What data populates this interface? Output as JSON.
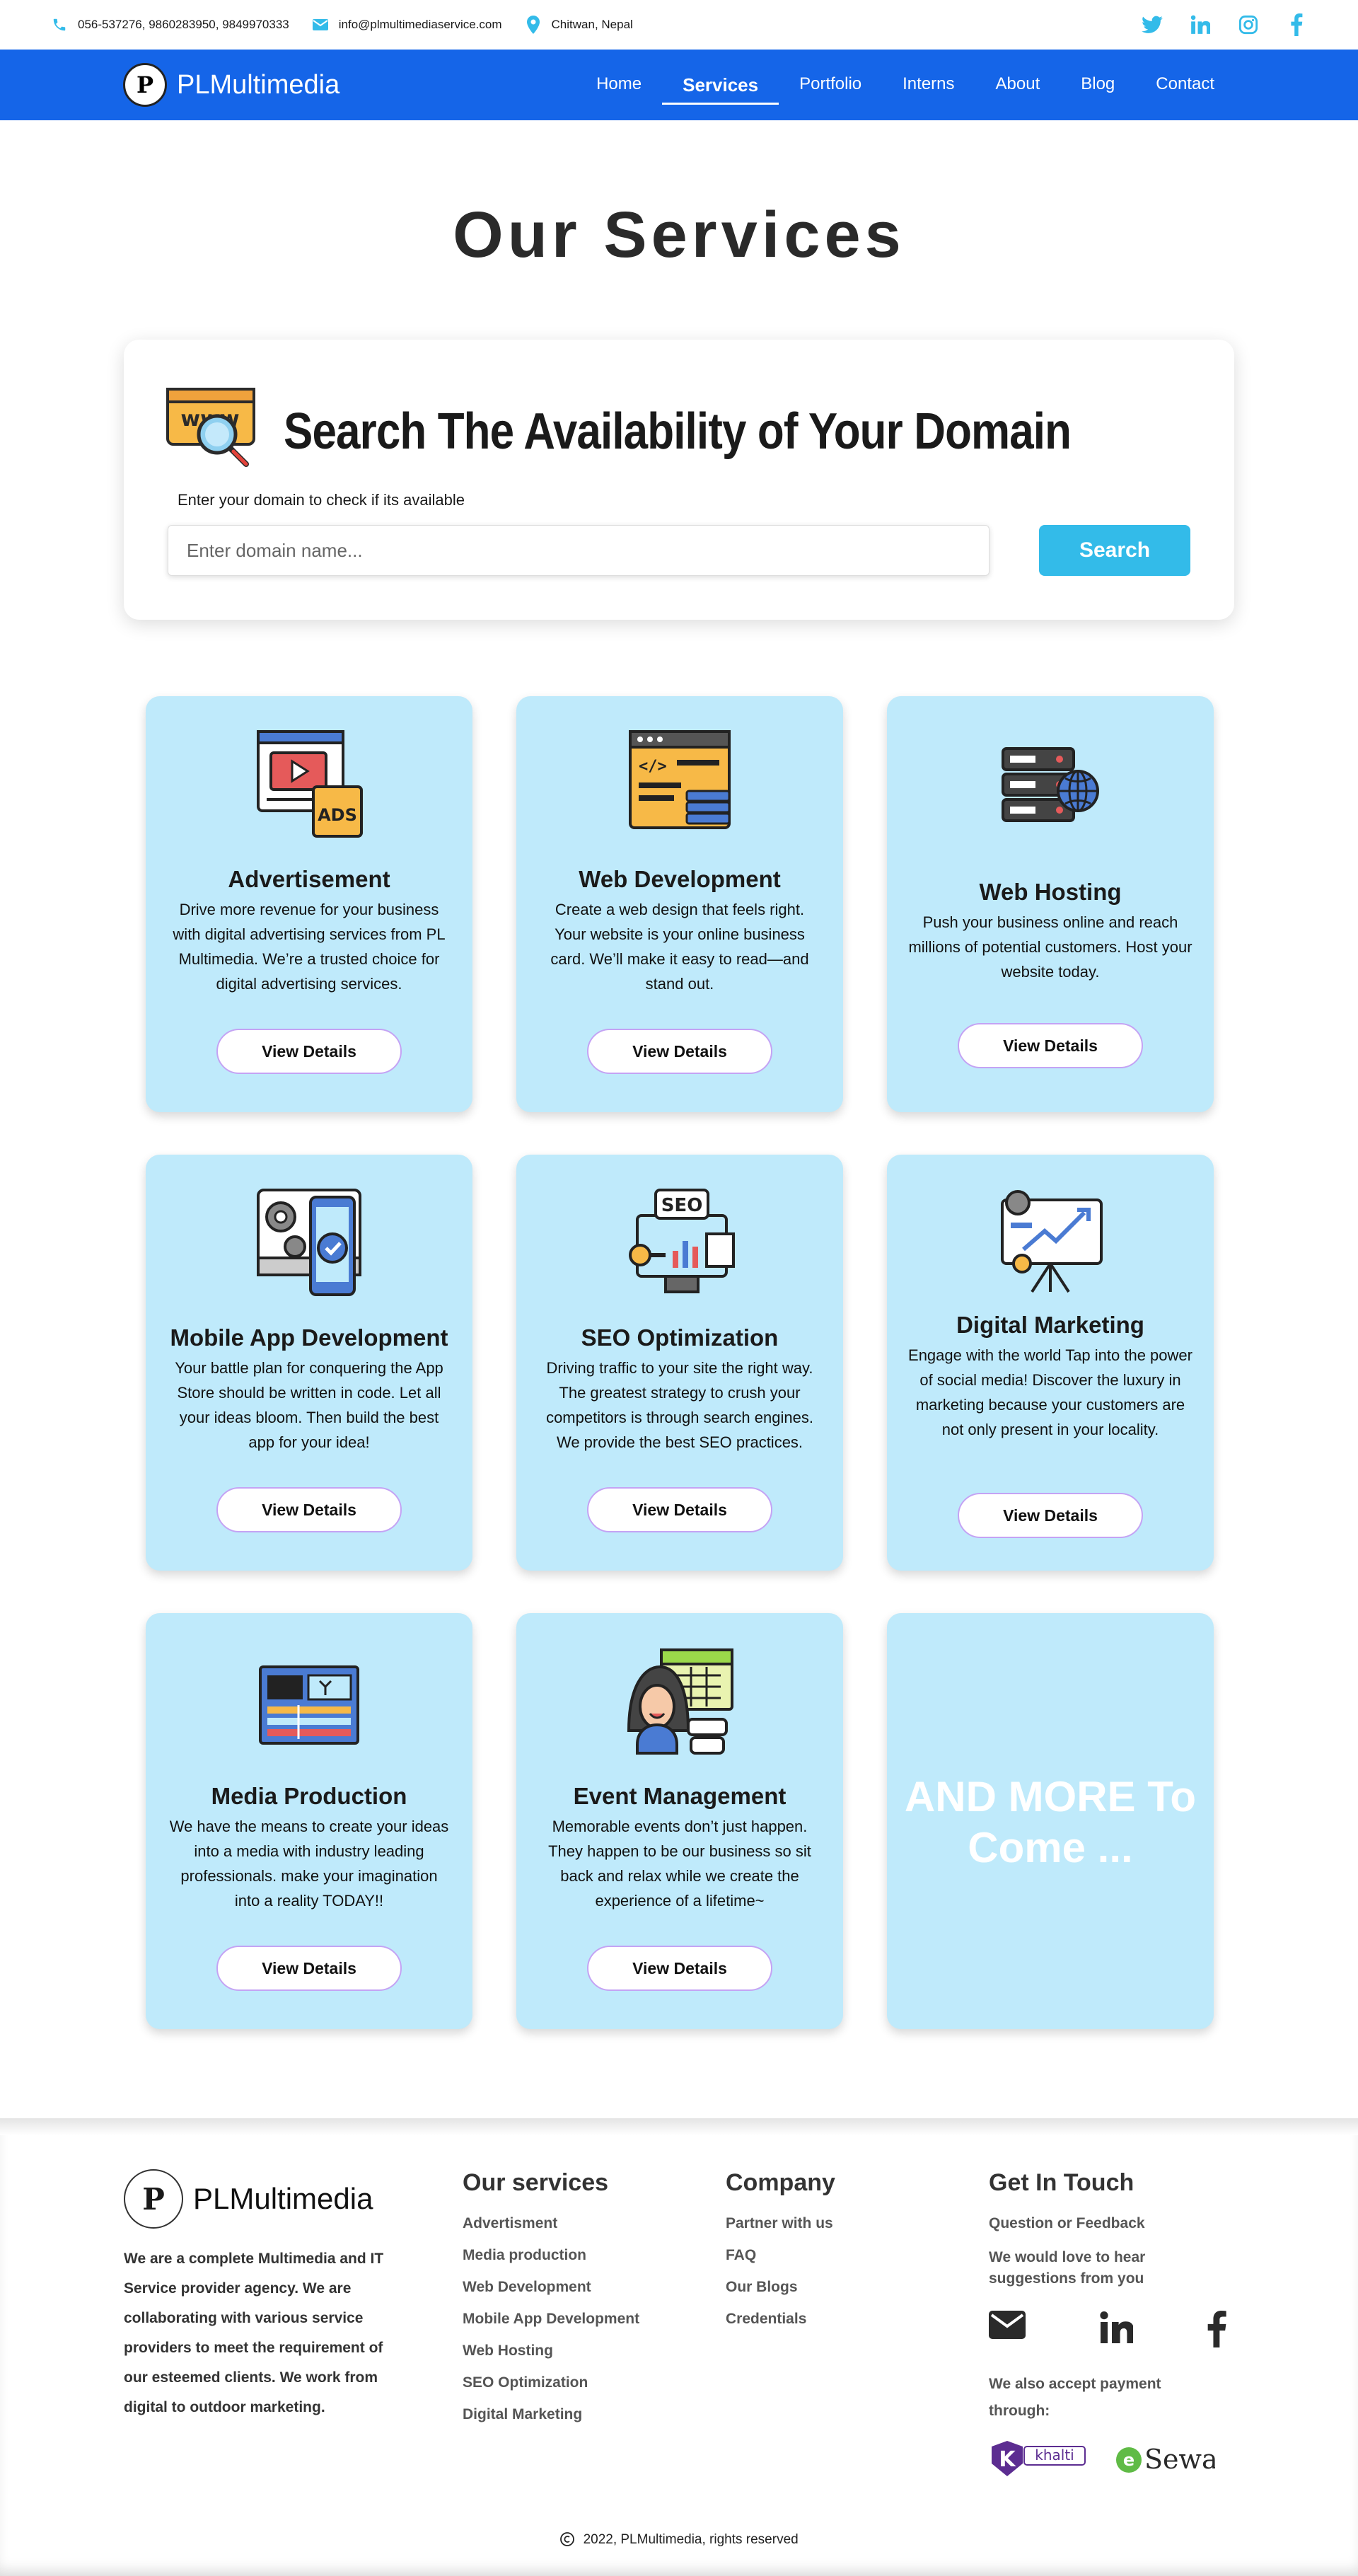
{
  "topbar": {
    "phone": "056-537276, 9860283950, 9849970333",
    "email": "info@plmultimediaservice.com",
    "location": "Chitwan, Nepal",
    "social_icons": [
      "twitter-icon",
      "linkedin-icon",
      "instagram-icon",
      "facebook-icon"
    ]
  },
  "nav": {
    "logo_mark": "P",
    "brand": "PLMultimedia",
    "items": [
      "Home",
      "Services",
      "Portfolio",
      "Interns",
      "About",
      "Blog",
      "Contact"
    ],
    "active": "Services"
  },
  "page_title": "Our Services",
  "domain": {
    "heading": "Search The Availability of Your Domain",
    "icon_text": "www",
    "hint": "Enter your domain to check if its available",
    "placeholder": "Enter domain name...",
    "button": "Search"
  },
  "services": [
    {
      "title": "Advertisement",
      "text": "Drive more revenue for your business with digital advertising services from PL Multimedia. We’re a trusted choice for digital advertising services.",
      "button": "View Details",
      "icon": "ads-icon",
      "icon_label": "ADS"
    },
    {
      "title": "Web Development",
      "text": "Create a web design that feels right. Your website is your online business card. We’ll make it easy to read—and stand out.",
      "button": "View Details",
      "icon": "code-window-icon"
    },
    {
      "title": "Web Hosting",
      "text": "Push your business online and reach millions of potential customers. Host your website today.",
      "button": "View Details",
      "icon": "server-globe-icon"
    },
    {
      "title": "Mobile App Development",
      "text": "Your battle plan for conquering the App Store should be written in code. Let all your ideas bloom. Then build the best app for your idea!",
      "button": "View Details",
      "icon": "mobile-app-icon"
    },
    {
      "title": "SEO Optimization",
      "text": "Driving traffic to your site the right way. The greatest strategy to crush your competitors is through search engines. We provide the best SEO practices.",
      "button": "View Details",
      "icon": "seo-monitor-icon",
      "icon_label": "SEO"
    },
    {
      "title": "Digital Marketing",
      "text": "Engage with the world Tap into the power of social media! Discover the luxury in marketing because your customers are not only present in your locality.",
      "button": "View Details",
      "icon": "marketing-board-icon"
    },
    {
      "title": "Media Production",
      "text": "We have the means to create your ideas into a media with industry leading professionals. make your imagination into a reality TODAY!!",
      "button": "View Details",
      "icon": "video-editor-icon"
    },
    {
      "title": "Event Management",
      "text": "Memorable events don’t just happen. They happen to be our business so sit back and relax while we create the experience of a lifetime~",
      "button": "View Details",
      "icon": "event-planner-icon"
    }
  ],
  "more_card": "AND MORE To Come ...",
  "footer": {
    "brand": "PLMultimedia",
    "about": "We are a complete Multimedia and IT Service provider agency. We are collaborating with various service providers to meet the requirement of our esteemed clients. We work from digital to outdoor marketing.",
    "services_title": "Our services",
    "services": [
      "Advertisment",
      "Media production",
      "Web Development",
      "Mobile App Development",
      "Web Hosting",
      "SEO Optimization",
      "Digital Marketing"
    ],
    "company_title": "Company",
    "company": [
      "Partner with us",
      "FAQ",
      "Our Blogs",
      "Credentials"
    ],
    "contact_title": "Get In Touch",
    "feedback": "Question or Feedback",
    "suggest": "We would love to hear suggestions from you",
    "payment_label": "We also accept payment through:",
    "khalti": "khalti",
    "khalti_mark": "K",
    "esewa_mark": "e",
    "esewa": "Sewa",
    "copyright": "2022, PLMultimedia, rights reserved"
  },
  "colors": {
    "nav": "#1565e8",
    "card": "#bfeafb",
    "accent": "#33bbe9",
    "icon": "#33bbe9"
  }
}
